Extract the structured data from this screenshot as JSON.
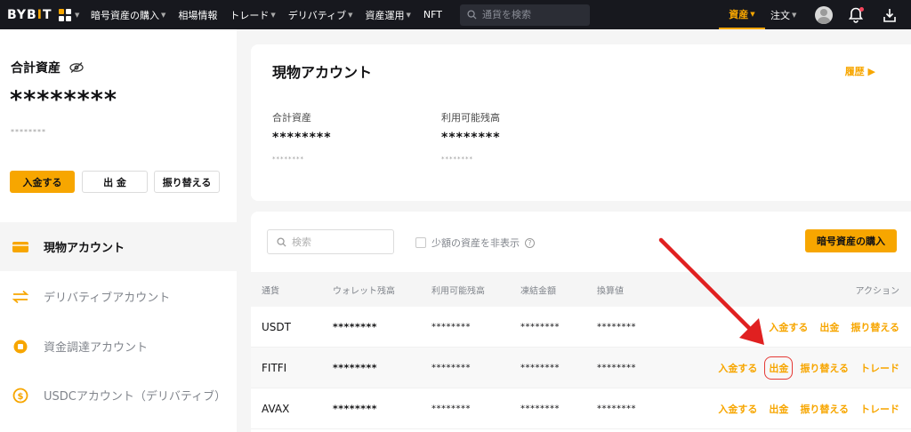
{
  "nav": {
    "logo_a": "BYB",
    "logo_b": "I",
    "logo_c": "T",
    "items": [
      "暗号資産の購入",
      "相場情報",
      "トレード",
      "デリバティブ",
      "資産運用",
      "NFT"
    ],
    "search_placeholder": "通貨を検索",
    "assets": "資産",
    "orders": "注文"
  },
  "left": {
    "total_label": "合計資産",
    "total_value": "********",
    "total_sub": "********",
    "deposit": "入金する",
    "withdraw": "出 金",
    "transfer": "振り替える",
    "accounts": [
      "現物アカウント",
      "デリバティブアカウント",
      "資金調達アカウント",
      "USDCアカウント（デリバティブ）"
    ]
  },
  "summary": {
    "title": "現物アカウント",
    "history": "履歴",
    "total_label": "合計資産",
    "total_value": "********",
    "total_sub": "********",
    "available_label": "利用可能残高",
    "available_value": "********",
    "available_sub": "********"
  },
  "table": {
    "search_placeholder": "検索",
    "hide_small": "少額の資産を非表示",
    "buy_button": "暗号資産の購入",
    "headers": [
      "通貨",
      "ウォレット残高",
      "利用可能残高",
      "凍結金額",
      "換算値",
      "アクション"
    ],
    "rows": [
      {
        "coin": "USDT",
        "wallet": "********",
        "available": "********",
        "frozen": "********",
        "value": "********",
        "actions": [
          "入金する",
          "出金",
          "振り替える"
        ]
      },
      {
        "coin": "FITFI",
        "wallet": "********",
        "available": "********",
        "frozen": "********",
        "value": "********",
        "actions": [
          "入金する",
          "出金",
          "振り替える",
          "トレード"
        ]
      },
      {
        "coin": "AVAX",
        "wallet": "********",
        "available": "********",
        "frozen": "********",
        "value": "********",
        "actions": [
          "入金する",
          "出金",
          "振り替える",
          "トレード"
        ]
      }
    ]
  },
  "colors": {
    "accent": "#f7a600",
    "nav_bg": "#17181e",
    "highlight": "#e53935"
  }
}
